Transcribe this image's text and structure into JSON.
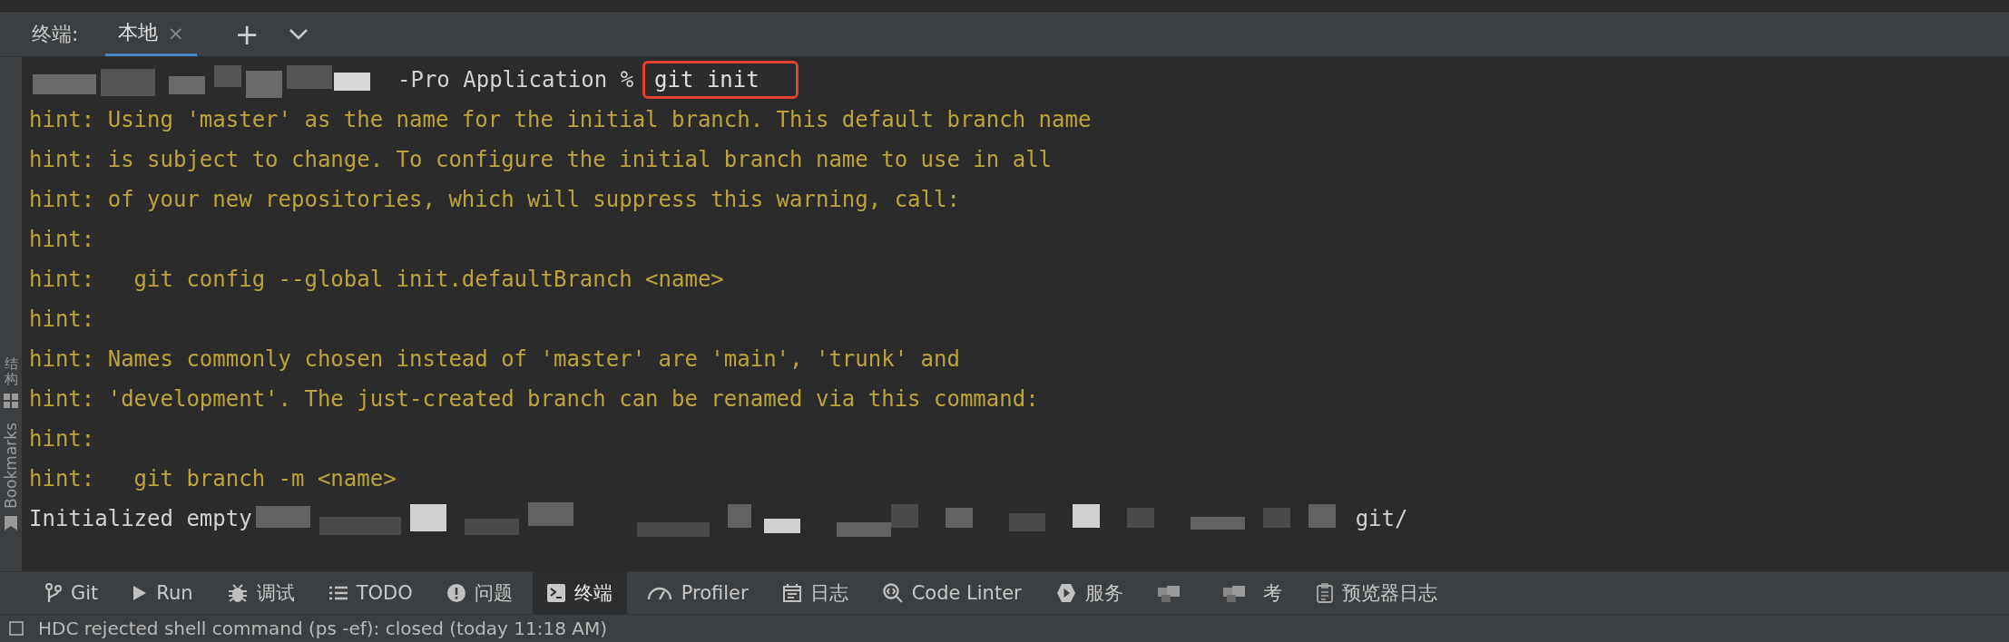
{
  "tool_window": {
    "title": "终端:",
    "tabs": [
      {
        "label": "本地",
        "close": "×",
        "selected": true
      }
    ],
    "add_button": "+"
  },
  "side_strip": [
    {
      "label": "结构",
      "kind": "cjk"
    },
    {
      "label": "Bookmarks",
      "kind": "latin"
    }
  ],
  "terminal": {
    "lines": [
      {
        "kind": "prompt",
        "text": "-Pro Application %",
        "command": "git init"
      },
      {
        "kind": "hint",
        "text": "hint: Using 'master' as the name for the initial branch. This default branch name"
      },
      {
        "kind": "hint",
        "text": "hint: is subject to change. To configure the initial branch name to use in all"
      },
      {
        "kind": "hint",
        "text": "hint: of your new repositories, which will suppress this warning, call:"
      },
      {
        "kind": "hint",
        "text": "hint:"
      },
      {
        "kind": "hint",
        "text": "hint:   git config --global init.defaultBranch <name>"
      },
      {
        "kind": "hint",
        "text": "hint:"
      },
      {
        "kind": "hint",
        "text": "hint: Names commonly chosen instead of 'master' are 'main', 'trunk' and"
      },
      {
        "kind": "hint",
        "text": "hint: 'development'. The just-created branch can be renamed via this command:"
      },
      {
        "kind": "hint",
        "text": "hint:"
      },
      {
        "kind": "hint",
        "text": "hint:   git branch -m <name>"
      },
      {
        "kind": "output",
        "text": "Initialized empty",
        "tail": "git/"
      }
    ]
  },
  "tool_bar": [
    {
      "label": "Git",
      "selected": false
    },
    {
      "label": "Run",
      "selected": false
    },
    {
      "label": "调试",
      "selected": false
    },
    {
      "label": "TODO",
      "selected": false
    },
    {
      "label": "问题",
      "selected": false
    },
    {
      "label": "终端",
      "selected": true
    },
    {
      "label": "Profiler",
      "selected": false
    },
    {
      "label": "日志",
      "selected": false
    },
    {
      "label": "Code Linter",
      "selected": false
    },
    {
      "label": "服务",
      "selected": false
    },
    {
      "selected": false
    },
    {
      "label": "考",
      "selected": false
    },
    {
      "label": "预览器日志",
      "selected": false
    }
  ],
  "status_bar": {
    "message": "HDC rejected shell command (ps -ef): closed (today 11:18 AM)"
  }
}
